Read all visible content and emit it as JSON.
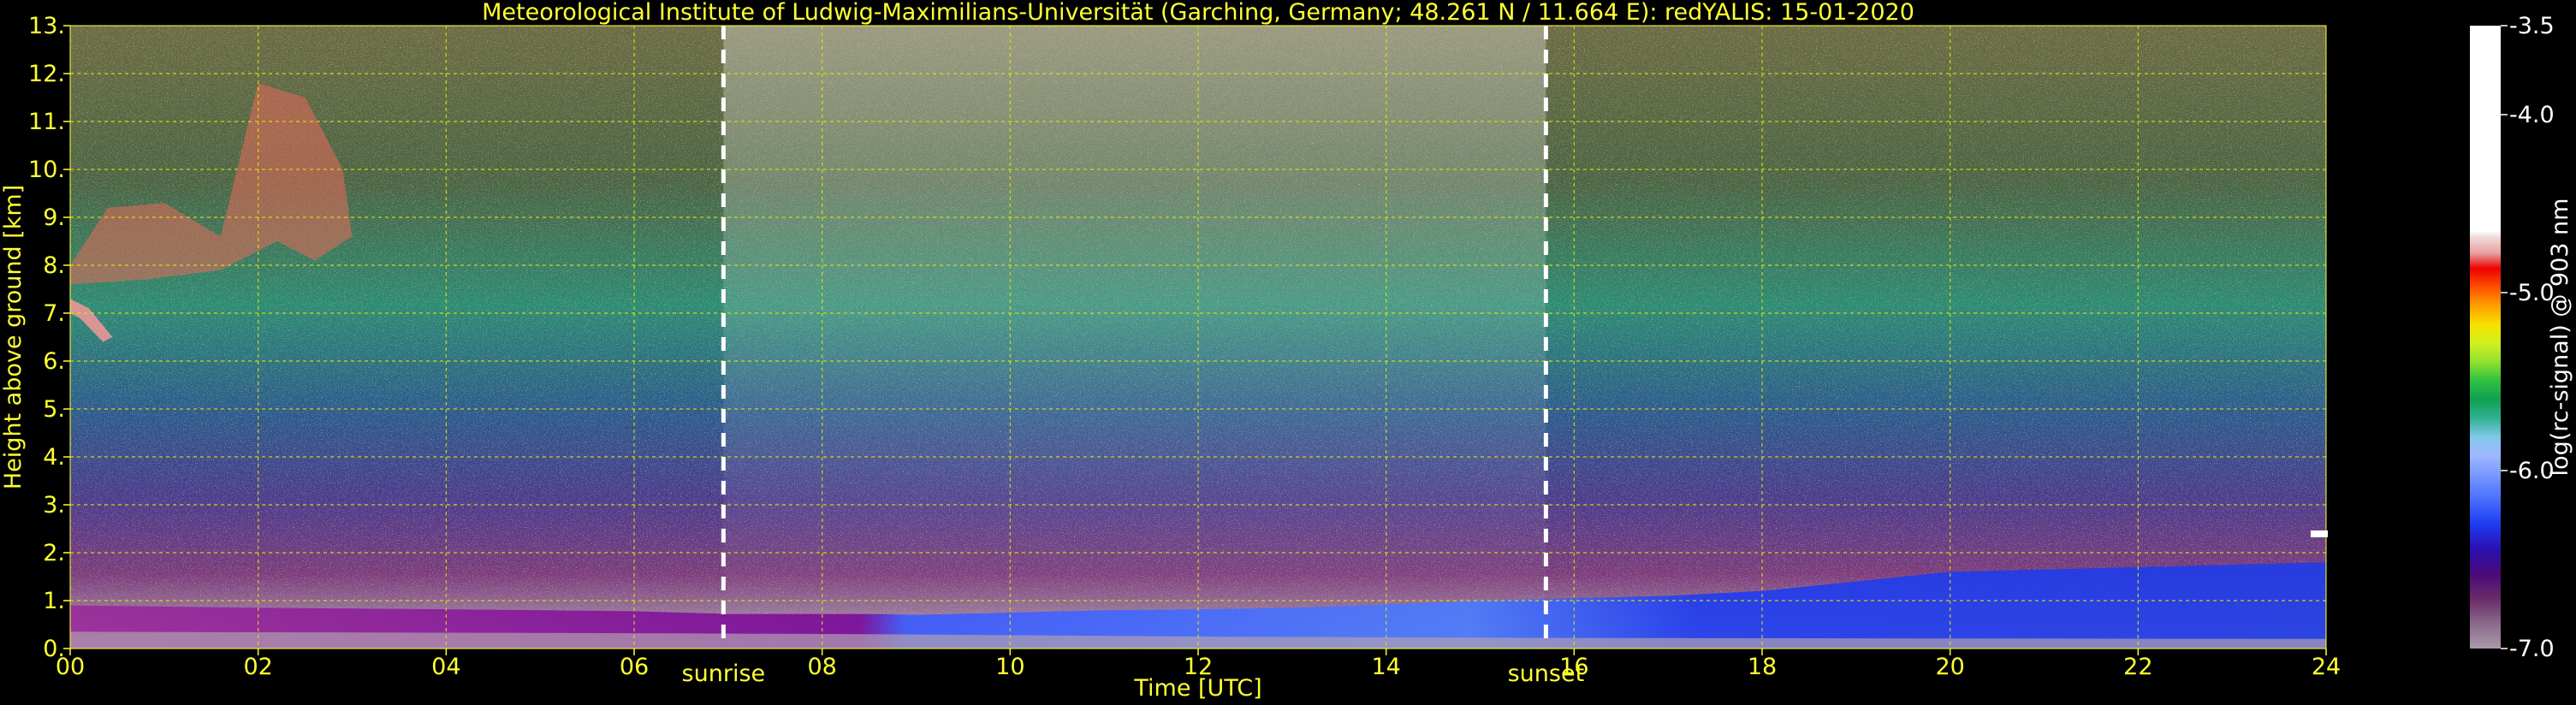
{
  "chart_data": {
    "type": "heatmap",
    "title": "Meteorological Institute of Ludwig-Maximilians-Universität (Garching, Germany; 48.261 N / 11.664 E):    redYALIS: 15-01-2020",
    "xlabel": "Time [UTC]",
    "ylabel": "Height above ground [km]",
    "xlim": [
      0,
      24
    ],
    "ylim": [
      0,
      13
    ],
    "x_ticks": [
      0,
      2,
      4,
      6,
      8,
      10,
      12,
      14,
      16,
      18,
      20,
      22,
      24
    ],
    "x_tick_labels": [
      "00",
      "02",
      "04",
      "06",
      "08",
      "10",
      "12",
      "14",
      "16",
      "18",
      "20",
      "22",
      "24"
    ],
    "y_ticks": [
      0,
      1,
      2,
      3,
      4,
      5,
      6,
      7,
      8,
      9,
      10,
      11,
      12,
      13
    ],
    "y_tick_labels": [
      "0.",
      "1.",
      "2.",
      "3.",
      "4.",
      "5.",
      "6.",
      "7.",
      "8.",
      "9.",
      "10.",
      "11.",
      "12.",
      "13."
    ],
    "grid": true,
    "annotations": [
      {
        "label": "sunrise",
        "x": 6.95
      },
      {
        "label": "sunset",
        "x": 15.7
      }
    ],
    "colorbar": {
      "label": "log(rc-signal) @ 903 nm",
      "range": [
        -7.0,
        -3.5
      ],
      "ticks": [
        -3.5,
        -4.0,
        -5.0,
        -6.0,
        -7.0
      ],
      "tick_labels": [
        "-3.5",
        "-4.0",
        "-5.0",
        "-6.0",
        "-7.0"
      ],
      "colors": [
        "#a89aa8",
        "#8a6a8a",
        "#6a2a6a",
        "#4a0a7a",
        "#2a10b0",
        "#1e3cf0",
        "#4a70ff",
        "#7a9aff",
        "#a0b8ff",
        "#80c8e8",
        "#30b090",
        "#10a050",
        "#30c040",
        "#90e030",
        "#d0f020",
        "#f8e000",
        "#ffa000",
        "#ff5000",
        "#ee0000",
        "#e8a0a0",
        "#f0d8d8",
        "#ffffff"
      ]
    },
    "layers": [
      {
        "name": "",
        "description_free": true
      }
    ]
  },
  "colors": {
    "text_accent": "#ffff33",
    "grid": "#e8e800",
    "background": "#000000",
    "marker": "#ffffff"
  }
}
